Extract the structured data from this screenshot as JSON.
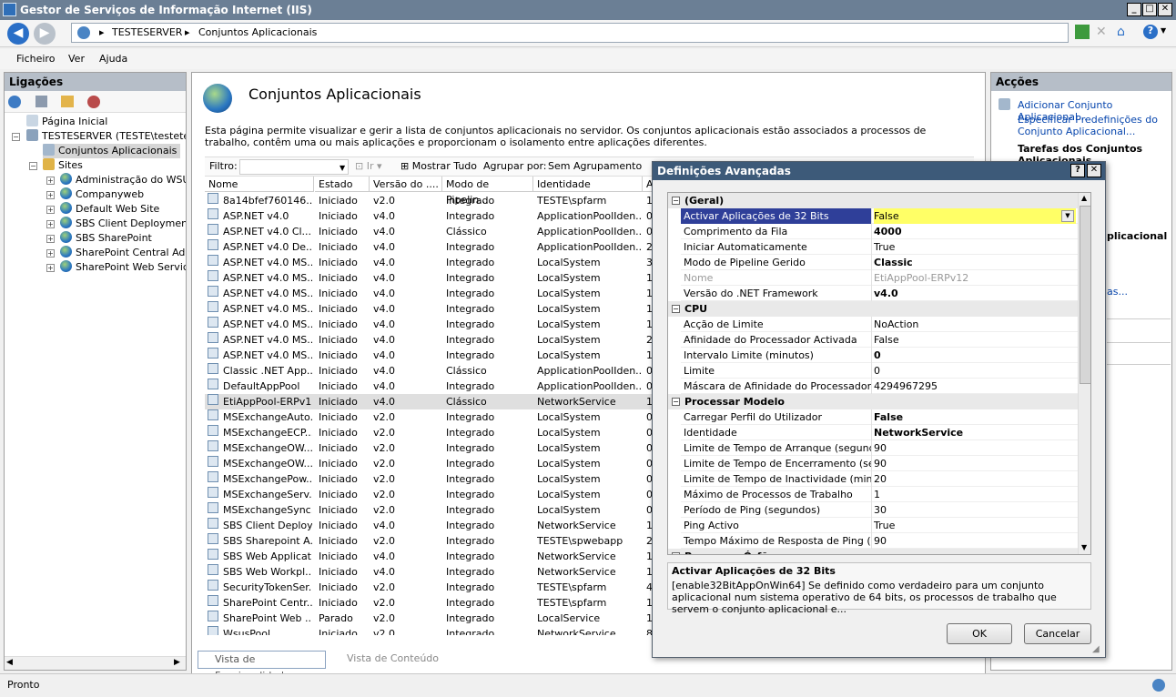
{
  "window": {
    "title": "Gestor de Serviços de Informação Internet (IIS)"
  },
  "address": {
    "crumbs": [
      "TESTESERVER",
      "Conjuntos Aplicacionais"
    ]
  },
  "menu": {
    "items": [
      "Ficheiro",
      "Ver",
      "Ajuda"
    ]
  },
  "left": {
    "header": "Ligações",
    "tree": {
      "start": "Página Inicial",
      "server": "TESTESERVER (TESTE\\testeteste)",
      "pools": "Conjuntos Aplicacionais",
      "sites": "Sites",
      "site_items": [
        "Administração do WSUS",
        "Companyweb",
        "Default Web Site",
        "SBS Client Deployment A",
        "SBS SharePoint",
        "SharePoint Central Admi",
        "SharePoint Web Services"
      ]
    }
  },
  "center": {
    "title": "Conjuntos Aplicacionais",
    "description": "Esta página permite visualizar e gerir a lista de conjuntos aplicacionais no servidor. Os conjuntos aplicacionais estão associados a processos de trabalho, contêm uma ou mais aplicações e proporcionam o isolamento entre aplicações diferentes.",
    "filter_label": "Filtro:",
    "go_label": "Ir",
    "show_all": "Mostrar Tudo",
    "group_by": "Agrupar por:",
    "group_value": "Sem Agrupamento",
    "columns": [
      "Nome",
      "Estado",
      "Versão do ....",
      "Modo de Pipelin...",
      "Identidade",
      "A"
    ],
    "rows": [
      [
        "8a14bfef760146...",
        "Iniciado",
        "v2.0",
        "Integrado",
        "TESTE\\spfarm",
        "1"
      ],
      [
        "ASP.NET v4.0",
        "Iniciado",
        "v4.0",
        "Integrado",
        "ApplicationPoolIden...",
        "0"
      ],
      [
        "ASP.NET v4.0 Cl...",
        "Iniciado",
        "v4.0",
        "Clássico",
        "ApplicationPoolIden...",
        "0"
      ],
      [
        "ASP.NET v4.0 De...",
        "Iniciado",
        "v4.0",
        "Integrado",
        "ApplicationPoolIden...",
        "2"
      ],
      [
        "ASP.NET v4.0 MS...",
        "Iniciado",
        "v4.0",
        "Integrado",
        "LocalSystem",
        "3"
      ],
      [
        "ASP.NET v4.0 MS...",
        "Iniciado",
        "v4.0",
        "Integrado",
        "LocalSystem",
        "1"
      ],
      [
        "ASP.NET v4.0 MS...",
        "Iniciado",
        "v4.0",
        "Integrado",
        "LocalSystem",
        "1"
      ],
      [
        "ASP.NET v4.0 MS...",
        "Iniciado",
        "v4.0",
        "Integrado",
        "LocalSystem",
        "1"
      ],
      [
        "ASP.NET v4.0 MS...",
        "Iniciado",
        "v4.0",
        "Integrado",
        "LocalSystem",
        "1"
      ],
      [
        "ASP.NET v4.0 MS...",
        "Iniciado",
        "v4.0",
        "Integrado",
        "LocalSystem",
        "2"
      ],
      [
        "ASP.NET v4.0 MS...",
        "Iniciado",
        "v4.0",
        "Integrado",
        "LocalSystem",
        "1"
      ],
      [
        "Classic .NET App...",
        "Iniciado",
        "v4.0",
        "Clássico",
        "ApplicationPoolIden...",
        "0"
      ],
      [
        "DefaultAppPool",
        "Iniciado",
        "v4.0",
        "Integrado",
        "ApplicationPoolIden...",
        "0"
      ],
      [
        "EtiAppPool-ERPv12",
        "Iniciado",
        "v4.0",
        "Clássico",
        "NetworkService",
        "1"
      ],
      [
        "MSExchangeAuto...",
        "Iniciado",
        "v2.0",
        "Integrado",
        "LocalSystem",
        "0"
      ],
      [
        "MSExchangeECP...",
        "Iniciado",
        "v2.0",
        "Integrado",
        "LocalSystem",
        "0"
      ],
      [
        "MSExchangeOW...",
        "Iniciado",
        "v2.0",
        "Integrado",
        "LocalSystem",
        "0"
      ],
      [
        "MSExchangeOW...",
        "Iniciado",
        "v2.0",
        "Integrado",
        "LocalSystem",
        "0"
      ],
      [
        "MSExchangePow...",
        "Iniciado",
        "v2.0",
        "Integrado",
        "LocalSystem",
        "0"
      ],
      [
        "MSExchangeServ...",
        "Iniciado",
        "v2.0",
        "Integrado",
        "LocalSystem",
        "0"
      ],
      [
        "MSExchangeSync...",
        "Iniciado",
        "v2.0",
        "Integrado",
        "LocalSystem",
        "0"
      ],
      [
        "SBS Client Deploy...",
        "Iniciado",
        "v4.0",
        "Integrado",
        "NetworkService",
        "1"
      ],
      [
        "SBS Sharepoint A...",
        "Iniciado",
        "v2.0",
        "Integrado",
        "TESTE\\spwebapp",
        "2"
      ],
      [
        "SBS Web Applicat...",
        "Iniciado",
        "v4.0",
        "Integrado",
        "NetworkService",
        "1"
      ],
      [
        "SBS Web Workpl...",
        "Iniciado",
        "v4.0",
        "Integrado",
        "NetworkService",
        "1"
      ],
      [
        "SecurityTokenSer...",
        "Iniciado",
        "v2.0",
        "Integrado",
        "TESTE\\spfarm",
        "4"
      ],
      [
        "SharePoint Centr...",
        "Iniciado",
        "v2.0",
        "Integrado",
        "TESTE\\spfarm",
        "1"
      ],
      [
        "SharePoint Web ...",
        "Parado",
        "v2.0",
        "Integrado",
        "LocalService",
        "1"
      ],
      [
        "WsusPool",
        "Iniciado",
        "v2.0",
        "Integrado",
        "NetworkService",
        "8"
      ]
    ],
    "tab_features": "Vista de Funcionalidades",
    "tab_content": "Vista de Conteúdo"
  },
  "right": {
    "header": "Acções",
    "add_link": "Adicionar Conjunto Aplicacional...",
    "defaults_link_1": "Especificar Predefinições do",
    "defaults_link_2": "Conjunto Aplicacional...",
    "tasks_header": "Tarefas dos Conjuntos",
    "tasks_header_2": "Aplicacionais",
    "partial_1": "plicacional",
    "partial_2": "as..."
  },
  "dialog": {
    "title": "Definições Avançadas",
    "help": "?",
    "close": "✕",
    "categories": {
      "general": "(Geral)",
      "cpu": "CPU",
      "process": "Processar Modelo",
      "orphan": "Processar Órfão"
    },
    "general": [
      [
        "Activar Aplicações de 32 Bits",
        "False"
      ],
      [
        "Comprimento da Fila",
        "4000"
      ],
      [
        "Iniciar Automaticamente",
        "True"
      ],
      [
        "Modo de Pipeline Gerido",
        "Classic"
      ],
      [
        "Nome",
        "EtiAppPool-ERPv12"
      ],
      [
        "Versão do .NET Framework",
        "v4.0"
      ]
    ],
    "cpu": [
      [
        "Acção de Limite",
        "NoAction"
      ],
      [
        "Afinidade do Processador Activada",
        "False"
      ],
      [
        "Intervalo Limite (minutos)",
        "0"
      ],
      [
        "Limite",
        "0"
      ],
      [
        "Máscara de Afinidade do Processador",
        "4294967295"
      ]
    ],
    "process": [
      [
        "Carregar Perfil do Utilizador",
        "False"
      ],
      [
        "Identidade",
        "NetworkService"
      ],
      [
        "Limite de Tempo de Arranque (segundos)",
        "90"
      ],
      [
        "Limite de Tempo de Encerramento (segundos)",
        "90"
      ],
      [
        "Limite de Tempo de Inactividade (minutos)",
        "20"
      ],
      [
        "Máximo de Processos de Trabalho",
        "1"
      ],
      [
        "Período de Ping (segundos)",
        "30"
      ],
      [
        "Ping Activo",
        "True"
      ],
      [
        "Tempo Máximo de Resposta de Ping (segundos)",
        "90"
      ]
    ],
    "desc_title": "Activar Aplicações de 32 Bits",
    "desc_text": "[enable32BitAppOnWin64] Se definido como verdadeiro para um conjunto aplicacional num sistema operativo de 64 bits, os processos de trabalho que servem o conjunto aplicacional e...",
    "ok": "OK",
    "cancel": "Cancelar"
  },
  "status": {
    "text": "Pronto"
  }
}
